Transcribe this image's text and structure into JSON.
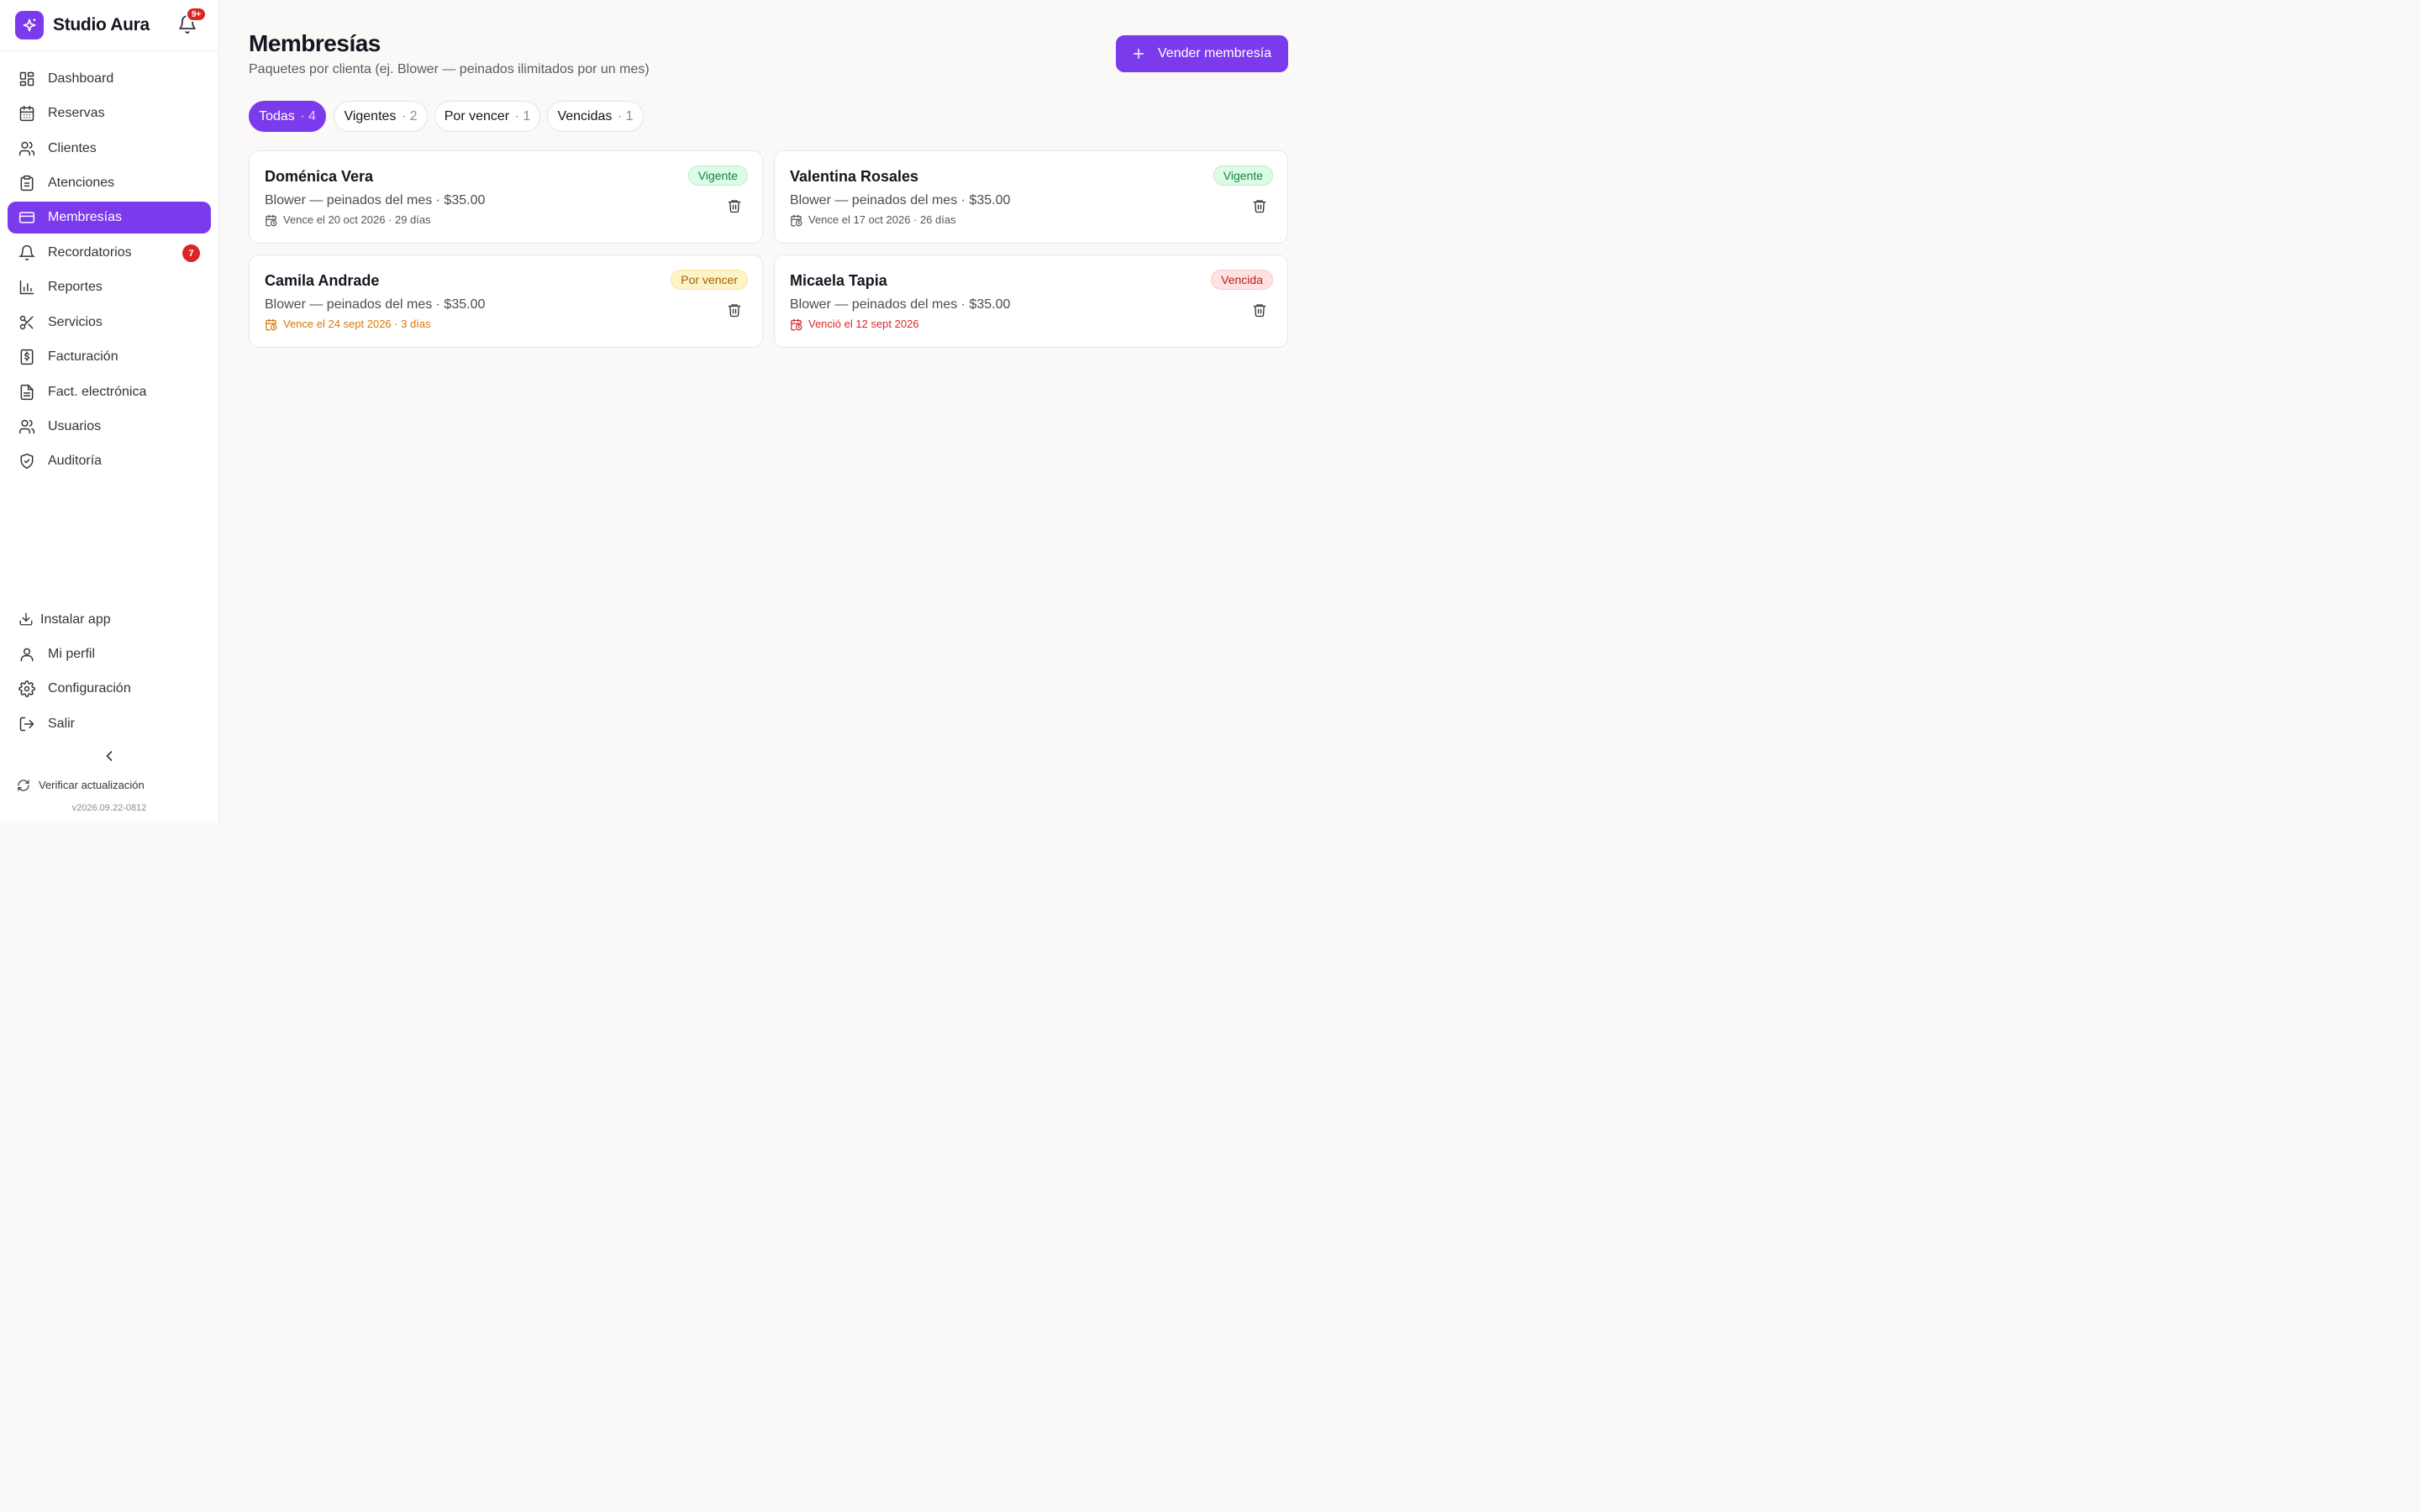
{
  "app": {
    "name": "Studio Aura",
    "notifications_badge": "9+",
    "accent_color": "#7c3aed"
  },
  "sidebar": {
    "items": [
      {
        "label": "Dashboard",
        "icon": "dashboard-icon"
      },
      {
        "label": "Reservas",
        "icon": "calendar-icon"
      },
      {
        "label": "Clientes",
        "icon": "users-icon"
      },
      {
        "label": "Atenciones",
        "icon": "clipboard-icon"
      },
      {
        "label": "Membresías",
        "icon": "card-icon",
        "active": true
      },
      {
        "label": "Recordatorios",
        "icon": "bell-icon",
        "badge": "7"
      },
      {
        "label": "Reportes",
        "icon": "bar-chart-icon"
      },
      {
        "label": "Servicios",
        "icon": "scissors-icon"
      },
      {
        "label": "Facturación",
        "icon": "receipt-icon"
      },
      {
        "label": "Fact. electrónica",
        "icon": "document-icon"
      },
      {
        "label": "Usuarios",
        "icon": "users-icon"
      },
      {
        "label": "Auditoría",
        "icon": "shield-check-icon"
      }
    ],
    "bottom": {
      "install": "Instalar app",
      "profile": "Mi perfil",
      "settings": "Configuración",
      "logout": "Salir"
    },
    "update_label": "Verificar actualización",
    "version": "v2026.09.22-0812"
  },
  "page": {
    "title": "Membresías",
    "subtitle": "Paquetes por clienta (ej. Blower — peinados ilimitados por un mes)",
    "primary_action": "Vender membresía"
  },
  "filters": [
    {
      "label": "Todas",
      "count": "· 4",
      "active": true
    },
    {
      "label": "Vigentes",
      "count": "· 2"
    },
    {
      "label": "Por vencer",
      "count": "· 1"
    },
    {
      "label": "Vencidas",
      "count": "· 1"
    }
  ],
  "memberships": [
    {
      "name": "Doménica Vera",
      "plan": "Blower — peinados del mes · $35.00",
      "expiry": "Vence el 20 oct 2026 · 29 días",
      "status": "Vigente",
      "status_color": "#15803d"
    },
    {
      "name": "Valentina Rosales",
      "plan": "Blower — peinados del mes · $35.00",
      "expiry": "Vence el 17 oct 2026 · 26 días",
      "status": "Vigente",
      "status_color": "#15803d"
    },
    {
      "name": "Camila Andrade",
      "plan": "Blower — peinados del mes · $35.00",
      "expiry": "Vence el 24 sept 2026 · 3 días",
      "status": "Por vencer",
      "status_color": "#a16207"
    },
    {
      "name": "Micaela Tapia",
      "plan": "Blower — peinados del mes · $35.00",
      "expiry": "Venció el 12 sept 2026",
      "status": "Vencida",
      "status_color": "#b91c1c"
    }
  ]
}
